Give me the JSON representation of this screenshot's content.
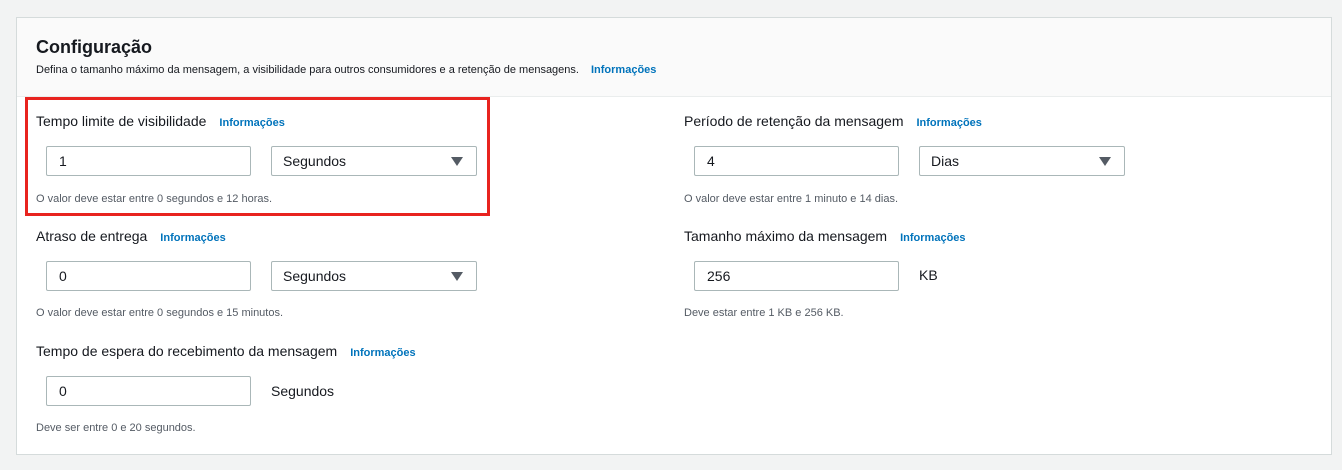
{
  "panel": {
    "title": "Configuração",
    "description": "Defina o tamanho máximo da mensagem, a visibilidade para outros consumidores e a retenção de mensagens.",
    "info_link": "Informações"
  },
  "fields": {
    "visibility_timeout": {
      "label": "Tempo limite de visibilidade",
      "info_link": "Informações",
      "value": "1",
      "unit": "Segundos",
      "hint": "O valor deve estar entre 0 segundos e 12 horas."
    },
    "retention_period": {
      "label": "Período de retenção da mensagem",
      "info_link": "Informações",
      "value": "4",
      "unit": "Dias",
      "hint": "O valor deve estar entre 1 minuto e 14 dias."
    },
    "delivery_delay": {
      "label": "Atraso de entrega",
      "info_link": "Informações",
      "value": "0",
      "unit": "Segundos",
      "hint": "O valor deve estar entre 0 segundos e 15 minutos."
    },
    "max_message_size": {
      "label": "Tamanho máximo da mensagem",
      "info_link": "Informações",
      "value": "256",
      "unit": "KB",
      "hint": "Deve estar entre 1 KB e 256 KB."
    },
    "receive_wait_time": {
      "label": "Tempo de espera do recebimento da mensagem",
      "info_link": "Informações",
      "value": "0",
      "unit": "Segundos",
      "hint": "Deve ser entre 0 e 20 segundos."
    }
  },
  "colors": {
    "link": "#0073bb",
    "highlight": "#e8231f"
  }
}
